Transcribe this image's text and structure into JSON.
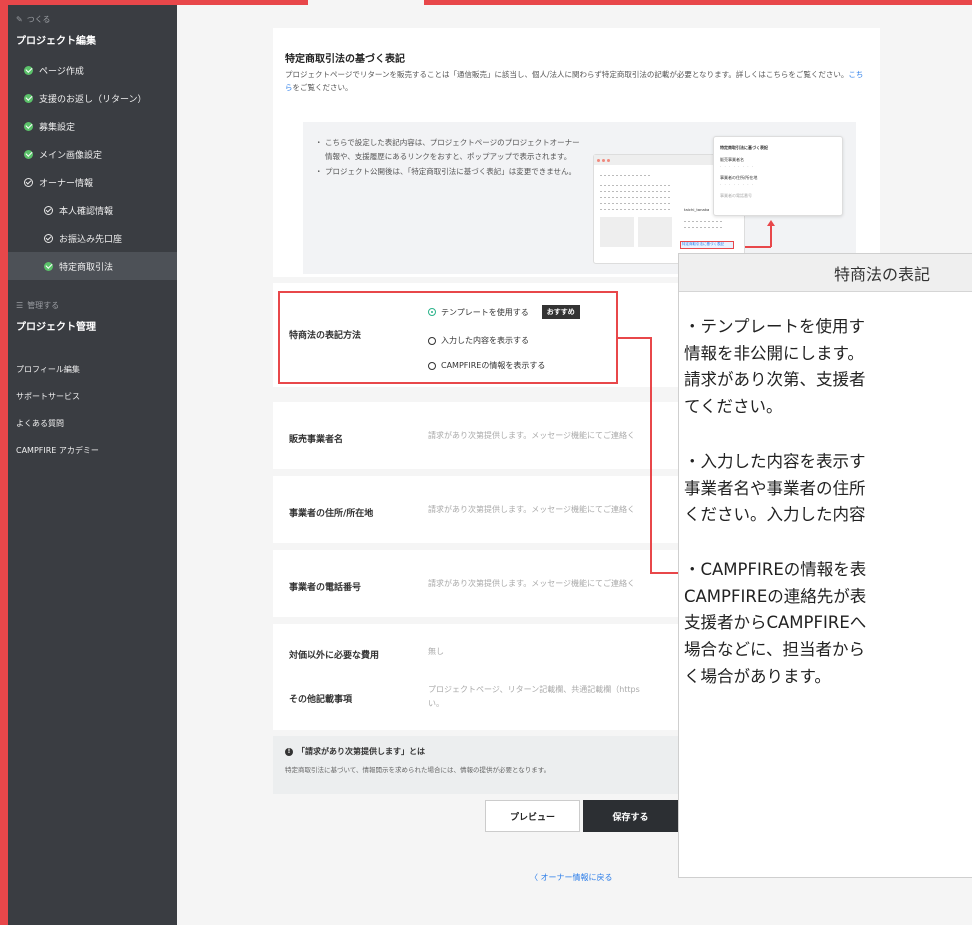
{
  "sidebar": {
    "create_section": "つくる",
    "project_edit": "プロジェクト編集",
    "items": [
      {
        "label": "ページ作成"
      },
      {
        "label": "支援のお返し（リターン）"
      },
      {
        "label": "募集設定"
      },
      {
        "label": "メイン画像設定"
      },
      {
        "label": "オーナー情報"
      },
      {
        "label": "本人確認情報"
      },
      {
        "label": "お振込み先口座"
      },
      {
        "label": "特定商取引法"
      }
    ],
    "manage_section": "管理する",
    "project_manage": "プロジェクト管理",
    "links": [
      "プロフィール編集",
      "サポートサービス",
      "よくある質問",
      "CAMPFIRE アカデミー"
    ]
  },
  "header_section": {
    "title": "特定商取引法の基づく表記",
    "desc_before_link": "プロジェクトページでリターンを販売することは「通信販売」に該当し、個人/法人に関わらず特定商取引法の記載が必要となります。詳しくはこちらをご覧ください。",
    "link": "こちら",
    "desc_after_link": "をご覧ください。",
    "notes": [
      "こちらで設定した表記内容は、プロジェクトページのプロジェクトオーナー情報や、支援履歴にあるリンクをおすと、ポップアップで表示されます。",
      "プロジェクト公開後は、「特定商取引法に基づく表記」は変更できません。"
    ],
    "illustration": {
      "card_title": "特定商取引法に基づく表記",
      "card_f1": "販売事業者名",
      "card_f2": "事業者の住所/所在地",
      "card_f3": "事業者の電話番号",
      "owner_name": "taichi_tanaka",
      "link_text": "特定商取引法に基づく表記"
    }
  },
  "method": {
    "label": "特商法の表記方法",
    "options": [
      "テンプレートを使用する",
      "入力した内容を表示する",
      "CAMPFIREの情報を表示する"
    ],
    "badge": "おすすめ"
  },
  "fields": [
    {
      "label": "販売事業者名",
      "value": "請求があり次第提供します。メッセージ機能にてご連絡く"
    },
    {
      "label": "事業者の住所/所在地",
      "value": "請求があり次第提供します。メッセージ機能にてご連絡く"
    },
    {
      "label": "事業者の電話番号",
      "value": "請求があり次第提供します。メッセージ機能にてご連絡く"
    },
    {
      "label": "対価以外に必要な費用",
      "value": "無し"
    },
    {
      "label": "その他記載事項",
      "value": "プロジェクトページ、リターン記載欄、共通記載欄（https",
      "value2": "い。"
    }
  ],
  "info": {
    "title": "「請求があり次第提供します」とは",
    "desc": "特定商取引法に基づいて、情報開示を求められた場合には、情報の提供が必要となります。"
  },
  "buttons": {
    "preview": "プレビュー",
    "save": "保存する",
    "back": "〈 オーナー情報に戻る"
  },
  "tooltip": {
    "title": "特商法の表記",
    "lines": [
      "・テンプレートを使用す",
      "情報を非公開にします。",
      "請求があり次第、支援者",
      "てください。",
      "",
      "・入力した内容を表示す",
      "事業者名や事業者の住所",
      "ください。入力した内容",
      "",
      "・CAMPFIREの情報を表",
      "CAMPFIREの連絡先が表",
      "支援者からCAMPFIREへ",
      "場合などに、担当者から",
      "く場合があります。"
    ]
  }
}
